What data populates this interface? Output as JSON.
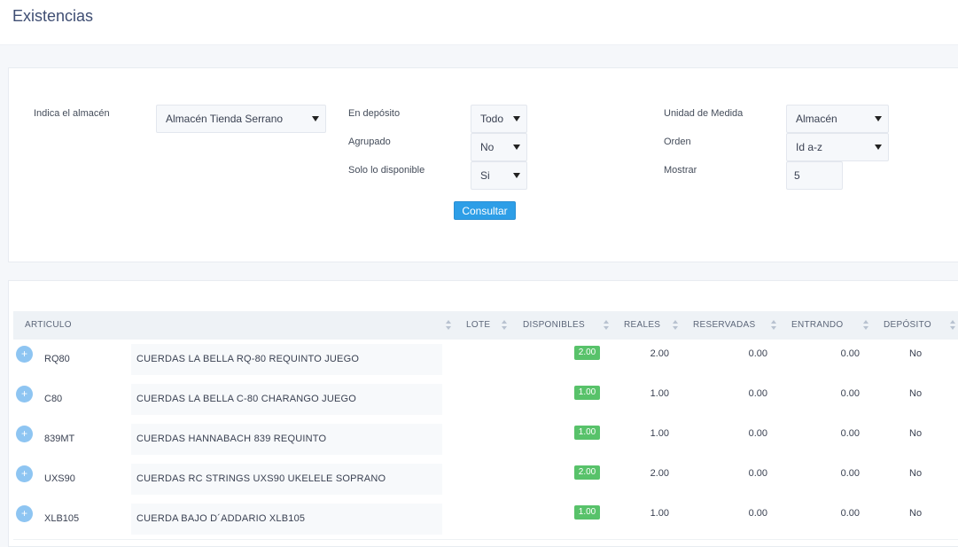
{
  "page": {
    "title": "Existencias"
  },
  "filters": {
    "warehouse_label": "Indica el almacén",
    "warehouse_value": "Almacén Tienda Serrano",
    "deposit_label": "En depósito",
    "deposit_value": "Todo",
    "grouped_label": "Agrupado",
    "grouped_value": "No",
    "available_label": "Solo lo disponible",
    "available_value": "Si",
    "unit_label": "Unidad de Medida",
    "unit_value": "Almacén",
    "order_label": "Orden",
    "order_value": "Id a-z",
    "show_label": "Mostrar",
    "show_value": "5",
    "submit_label": "Consultar"
  },
  "table": {
    "columns": {
      "articulo": "ARTICULO",
      "lote": "LOTE",
      "disponibles": "DISPONIBLES",
      "reales": "REALES",
      "reservadas": "RESERVADAS",
      "entrando": "ENTRANDO",
      "deposito": "DEPÓSITO"
    },
    "expand_symbol": "+",
    "rows": [
      {
        "code": "RQ80",
        "description": "CUERDAS LA BELLA RQ-80 REQUINTO JUEGO",
        "disponibles": "2.00",
        "reales": "2.00",
        "reservadas": "0.00",
        "entrando": "0.00",
        "deposito": "No"
      },
      {
        "code": "C80",
        "description": "CUERDAS LA BELLA C-80 CHARANGO JUEGO",
        "disponibles": "1.00",
        "reales": "1.00",
        "reservadas": "0.00",
        "entrando": "0.00",
        "deposito": "No"
      },
      {
        "code": "839MT",
        "description": "CUERDAS HANNABACH 839 REQUINTO",
        "disponibles": "1.00",
        "reales": "1.00",
        "reservadas": "0.00",
        "entrando": "0.00",
        "deposito": "No"
      },
      {
        "code": "UXS90",
        "description": "CUERDAS RC STRINGS UXS90 UKELELE SOPRANO",
        "disponibles": "2.00",
        "reales": "2.00",
        "reservadas": "0.00",
        "entrando": "0.00",
        "deposito": "No"
      },
      {
        "code": "XLB105",
        "description": "CUERDA BAJO D´ADDARIO XLB105",
        "disponibles": "1.00",
        "reales": "1.00",
        "reservadas": "0.00",
        "entrando": "0.00",
        "deposito": "No"
      }
    ]
  },
  "colors": {
    "accent": "#2d9ee7",
    "badge": "#58c26a",
    "title": "#3f4e73"
  }
}
